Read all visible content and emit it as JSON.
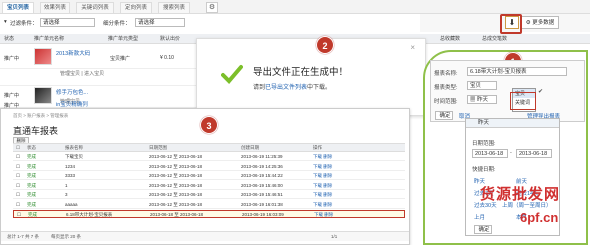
{
  "tabs": [
    "宝贝列表",
    "效果列表",
    "关键词列表",
    "定向列表",
    "搜索列表"
  ],
  "filter": {
    "label_ad": "过滤条件：",
    "ad_value": "请选择",
    "label_cat": "细分条件：",
    "cat_value": "请选择"
  },
  "table_headers": [
    "状态",
    "推广单元名称",
    "推广单元类型",
    "默认出价",
    "总收藏数",
    "总成交笔数"
  ],
  "products": [
    {
      "status": "推广中",
      "title": "2013新款大码",
      "sub": "",
      "type": "宝贝推广",
      "price": "¥ 0.10"
    },
    {
      "status": "",
      "title": "",
      "sub": "管理宝贝 | 进入宝贝",
      "type": "",
      "price": ""
    },
    {
      "status": "推广中",
      "title": "修手万包色...",
      "sub": "管理宝贝",
      "type": "",
      "price": ""
    },
    {
      "status": "推广中",
      "title": "in宝贝精确列",
      "sub": "",
      "type": "",
      "price": ""
    }
  ],
  "dialog": {
    "title": "导出文件正在生成中！",
    "sub_prefix": "请到",
    "sub_link": "已导出文件列表",
    "sub_suffix": "中下载。",
    "close": "×"
  },
  "badges": {
    "one": "1",
    "two": "2",
    "three": "3"
  },
  "toolbar": {
    "download": "⬇",
    "more": "更多数据"
  },
  "form": {
    "name_label": "报表名称:",
    "name_value": "6.18带大计划-宝贝报表",
    "type_label": "报表类型:",
    "type_value": "宝贝",
    "opt1": "宝贝",
    "opt2": "关键词",
    "time_label": "时间范围:",
    "time_value": "昨天",
    "confirm": "确定",
    "cancel": "取消",
    "manage": "管理导出报表"
  },
  "date_panel": {
    "head": "昨天",
    "range_label": "日期范围:",
    "start": "2013-06-18",
    "sep": "-",
    "end": "2013-06-18",
    "quick_label": "快捷日期:",
    "links": [
      [
        "昨天",
        "前天"
      ],
      [
        "过去7天",
        "过去14天"
      ],
      [
        "过去30天",
        "上周（周一至周日）"
      ],
      [
        "上月",
        "本月"
      ]
    ],
    "ok": "确定"
  },
  "report": {
    "breadcrumb": "首页 > 账户报表 > 管理报表",
    "title": "直通车报表",
    "delete": "删除",
    "headers": [
      "状态",
      "报表名称",
      "日期范围",
      "创建日期",
      "操作"
    ],
    "rows": [
      [
        "完成",
        "下载宝贝",
        "2013-06-12 至 2013-06-18",
        "2013-06-19 11:25:39",
        "下载 删除"
      ],
      [
        "完成",
        "1234",
        "2013-06-12 至 2013-06-18",
        "2013-06-19 14:25:36",
        "下载 删除"
      ],
      [
        "完成",
        "3333",
        "2013-06-12 至 2013-06-18",
        "2013-06-19 15:44:22",
        "下载 删除"
      ],
      [
        "完成",
        "1",
        "2013-06-12 至 2013-06-18",
        "2013-06-19 15:46:00",
        "下载 删除"
      ],
      [
        "完成",
        "3",
        "2013-06-12 至 2013-06-18",
        "2013-06-19 15:46:51",
        "下载 删除"
      ],
      [
        "完成",
        "aaaaa",
        "2013-06-12 至 2013-06-18",
        "2013-06-19 16:01:38",
        "下载 删除"
      ],
      [
        "完成",
        "6.18带大计划-宝贝报表",
        "2013-06-18 至 2013-06-18",
        "2013-06-19 16:03:09",
        "下载 删除"
      ]
    ],
    "footer_left": "总计 1-7 共 7 条",
    "footer_mid": "每页显示 20 条",
    "footer_right": "1/1"
  },
  "watermark": {
    "line1": "货源批发网",
    "line2": "6pf.cn"
  }
}
